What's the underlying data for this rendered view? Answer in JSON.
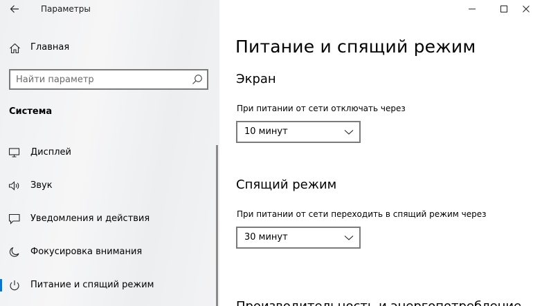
{
  "window": {
    "title": "Параметры",
    "controls": {
      "minimize_icon": "minimize-icon",
      "maximize_icon": "maximize-icon",
      "close_icon": "close-icon"
    }
  },
  "sidebar": {
    "home_label": "Главная",
    "search_placeholder": "Найти параметр",
    "section_title": "Система",
    "items": [
      {
        "label": "Дисплей",
        "icon": "monitor-icon"
      },
      {
        "label": "Звук",
        "icon": "speaker-icon"
      },
      {
        "label": "Уведомления и действия",
        "icon": "notification-icon"
      },
      {
        "label": "Фокусировка внимания",
        "icon": "focus-moon-icon"
      },
      {
        "label": "Питание и спящий режим",
        "icon": "power-icon",
        "active": true
      }
    ]
  },
  "main": {
    "page_title": "Питание и спящий режим",
    "screen": {
      "heading": "Экран",
      "label": "При питании от сети отключать через",
      "value": "10 минут"
    },
    "sleep": {
      "heading": "Спящий режим",
      "label": "При питании от сети переходить в спящий режим через",
      "value": "30 минут"
    },
    "next_heading": "Производительность и энергопотребление"
  },
  "colors": {
    "accent": "#0078d7",
    "sidebar_bg": "#f2f2f2"
  }
}
